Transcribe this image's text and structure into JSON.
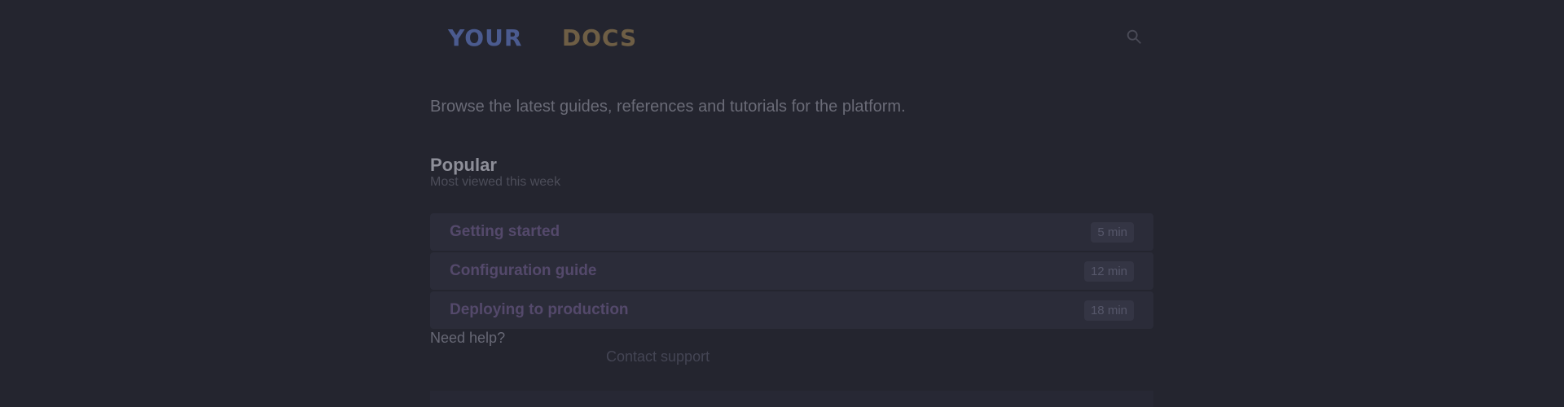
{
  "header": {
    "logo": {
      "primary": "YOUR",
      "secondary": "DOCS"
    },
    "action_icon": "search-icon"
  },
  "intro": {
    "text": "Browse the latest guides, references and tutorials for the platform."
  },
  "section": {
    "title": "Popular",
    "subtitle": "Most viewed this week"
  },
  "cards": [
    {
      "title": "Getting started",
      "meta": "5 min"
    },
    {
      "title": "Configuration guide",
      "meta": "12 min"
    },
    {
      "title": "Deploying to production",
      "meta": "18 min"
    }
  ],
  "footer": {
    "note": "Need help?",
    "link": "Contact support"
  },
  "colors": {
    "background": "#24252f",
    "card": "#2b2c39",
    "accent_blue": "#4b5b8f",
    "accent_gold": "#6e5e45",
    "accent_purple": "#54496b"
  }
}
